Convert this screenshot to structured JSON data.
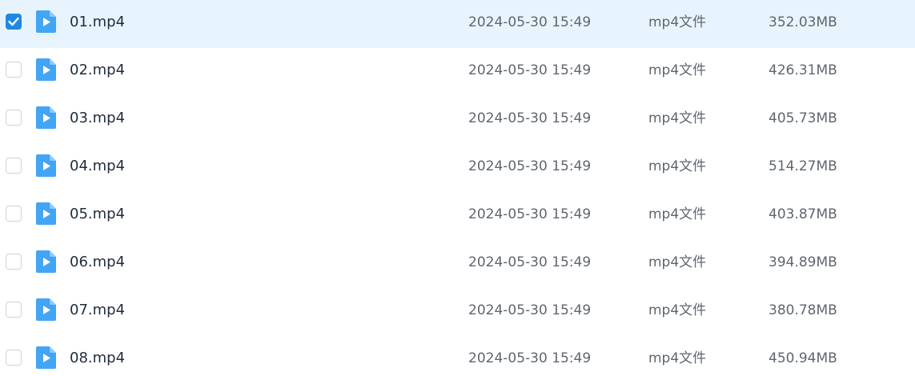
{
  "files": [
    {
      "name": "01.mp4",
      "date": "2024-05-30 15:49",
      "type": "mp4文件",
      "size": "352.03MB",
      "checked": true
    },
    {
      "name": "02.mp4",
      "date": "2024-05-30 15:49",
      "type": "mp4文件",
      "size": "426.31MB",
      "checked": false
    },
    {
      "name": "03.mp4",
      "date": "2024-05-30 15:49",
      "type": "mp4文件",
      "size": "405.73MB",
      "checked": false
    },
    {
      "name": "04.mp4",
      "date": "2024-05-30 15:49",
      "type": "mp4文件",
      "size": "514.27MB",
      "checked": false
    },
    {
      "name": "05.mp4",
      "date": "2024-05-30 15:49",
      "type": "mp4文件",
      "size": "403.87MB",
      "checked": false
    },
    {
      "name": "06.mp4",
      "date": "2024-05-30 15:49",
      "type": "mp4文件",
      "size": "394.89MB",
      "checked": false
    },
    {
      "name": "07.mp4",
      "date": "2024-05-30 15:49",
      "type": "mp4文件",
      "size": "380.78MB",
      "checked": false
    },
    {
      "name": "08.mp4",
      "date": "2024-05-30 15:49",
      "type": "mp4文件",
      "size": "450.94MB",
      "checked": false
    }
  ],
  "icons": {
    "file": "video-file-icon",
    "check": "checkmark-icon"
  },
  "colors": {
    "selected_row": "#e8f4fd",
    "accent": "#1e88e5",
    "icon": "#42a5f5"
  }
}
